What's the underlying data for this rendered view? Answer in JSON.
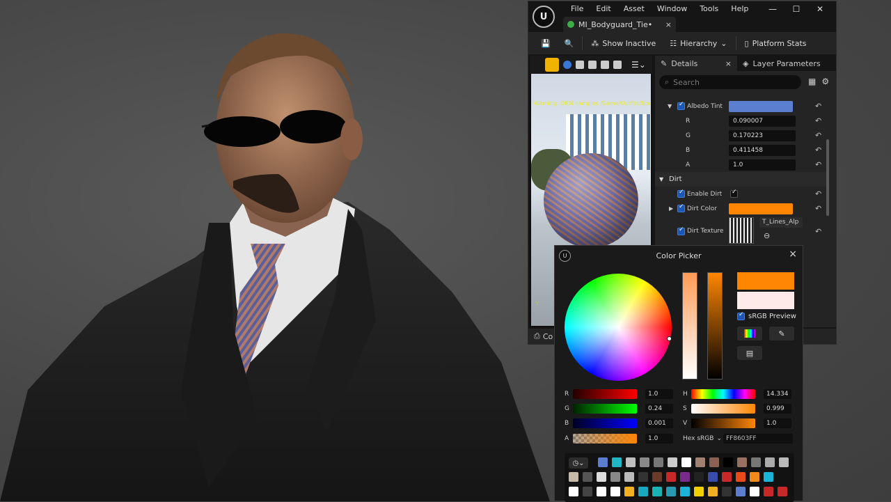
{
  "menu": [
    "File",
    "Edit",
    "Asset",
    "Window",
    "Tools",
    "Help"
  ],
  "asset_tab": {
    "label": "MI_Bodyguard_Tie•",
    "close": "×"
  },
  "window_controls": {
    "minimize": "—",
    "maximize": "☐",
    "close": "✕"
  },
  "toolbar": {
    "show_inactive": "Show Inactive",
    "hierarchy": "Hierarchy",
    "platform_stats": "Platform Stats"
  },
  "viewport": {
    "warning": "Warning: ORM samples /Game/Outfits/Body",
    "axis": "Y"
  },
  "details_tabs": {
    "details": "Details",
    "details_close": "×",
    "layer_params": "Layer Parameters"
  },
  "details_search": {
    "placeholder": "Search"
  },
  "props": {
    "albedo_tint": "Albedo Tint",
    "r_label": "R",
    "r_value": "0.090007",
    "g_label": "G",
    "g_value": "0.170223",
    "b_label": "B",
    "b_value": "0.411458",
    "a_label": "A",
    "a_value": "1.0",
    "dirt_group": "Dirt",
    "enable_dirt": "Enable Dirt",
    "dirt_color": "Dirt Color",
    "dirt_texture": "Dirt Texture",
    "texture_name": "T_Lines_Alp"
  },
  "bottom_tab": {
    "label": "Co"
  },
  "color_picker": {
    "title": "Color Picker",
    "close": "×",
    "srgb_preview": "sRGB Preview",
    "r_label": "R",
    "r_value": "1.0",
    "g_label": "G",
    "g_value": "0.24",
    "b_label": "B",
    "b_value": "0.001",
    "a_label": "A",
    "a_value": "1.0",
    "h_label": "H",
    "h_value": "14.334",
    "s_label": "S",
    "s_value": "0.999",
    "v_label": "V",
    "v_value": "1.0",
    "hex_label": "Hex sRGB",
    "hex_value": "FF8603FF"
  },
  "colors": {
    "accent_orange": "#ff8603",
    "albedo_tint": "#5b7ecf",
    "ue_blue": "#1c57b8"
  }
}
